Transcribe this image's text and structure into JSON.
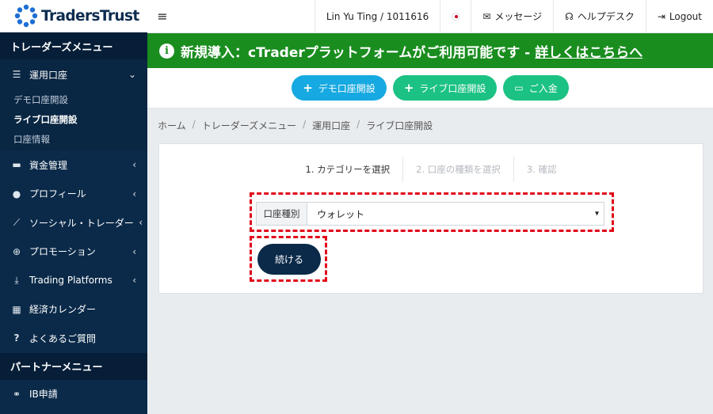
{
  "brand": {
    "logo_text": "TradersTrust"
  },
  "sidebar": {
    "trader_menu_title": "トレーダーズメニュー",
    "account_menu": {
      "label": "運用口座",
      "subitems": [
        "デモ口座開設",
        "ライブ口座開設",
        "口座情報"
      ]
    },
    "items": [
      {
        "label": "資金管理",
        "icon": "wallet-icon"
      },
      {
        "label": "プロフィール",
        "icon": "user-icon"
      },
      {
        "label": "ソーシャル・トレーダー",
        "icon": "chart-icon"
      },
      {
        "label": "プロモーション",
        "icon": "globe-icon"
      },
      {
        "label": "Trading Platforms",
        "icon": "download-icon"
      },
      {
        "label": "経済カレンダー",
        "icon": "calendar-icon"
      },
      {
        "label": "よくあるご質問",
        "icon": "question-icon"
      }
    ],
    "partner_menu_title": "パートナーメニュー",
    "partner_items": [
      {
        "label": "IB申請",
        "icon": "handshake-icon"
      }
    ]
  },
  "topbar": {
    "user": "Lin Yu Ting / 1011616",
    "language": "Japanese flag",
    "messages": "メッセージ",
    "helpdesk": "ヘルプデスク",
    "logout": "Logout"
  },
  "banner": {
    "text": "新規導入：cTraderプラットフォームがご利用可能です -",
    "link": "詳しくはこちらへ"
  },
  "actions": {
    "demo": "デモ口座開設",
    "live": "ライブ口座開設",
    "deposit": "ご入金"
  },
  "breadcrumb": [
    "ホーム",
    "トレーダーズメニュー",
    "運用口座",
    "ライブ口座開設"
  ],
  "steps": [
    "1. カテゴリーを選択",
    "2. 口座の種類を選択",
    "3. 確認"
  ],
  "form": {
    "account_type_label": "口座種別",
    "account_type_value": "ウォレット",
    "continue": "続ける"
  },
  "colors": {
    "sidebar": "#0b2a49",
    "banner": "#1a8d1f",
    "pill_blue": "#17a9e1",
    "pill_green": "#1bc283",
    "highlight": "#e0061a"
  }
}
